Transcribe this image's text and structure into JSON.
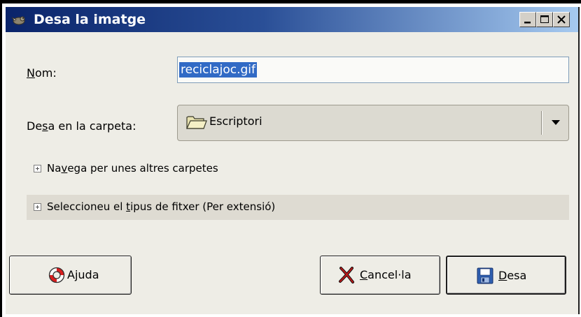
{
  "window": {
    "title": "Desa la imatge",
    "icons": [
      "gimp-icon",
      "minimize-icon",
      "maximize-icon",
      "close-icon"
    ]
  },
  "form": {
    "name_label_pre": "",
    "name_label_u": "N",
    "name_label_post": "om:",
    "name_value": "reciclajoc.gif",
    "folder_label_pre": "De",
    "folder_label_u": "s",
    "folder_label_post": "a en la carpeta:",
    "folder_value": "Escriptori",
    "folder_icon": "folder-icon"
  },
  "expanders": {
    "browse_pre": "Na",
    "browse_u": "v",
    "browse_post": "ega per unes altres carpetes",
    "filetype_pre": "Seleccioneu el ",
    "filetype_u": "t",
    "filetype_post": "ipus de fitxer (Per extensió)"
  },
  "buttons": {
    "help_label": "Ajuda",
    "cancel_pre": "",
    "cancel_u": "C",
    "cancel_post": "ancel·la",
    "save_pre": "",
    "save_u": "D",
    "save_post": "esa"
  },
  "colors": {
    "titlebar_start": "#0a246a",
    "titlebar_end": "#a6caf0",
    "selection": "#316ac5",
    "dialog_bg": "#eeede6"
  }
}
